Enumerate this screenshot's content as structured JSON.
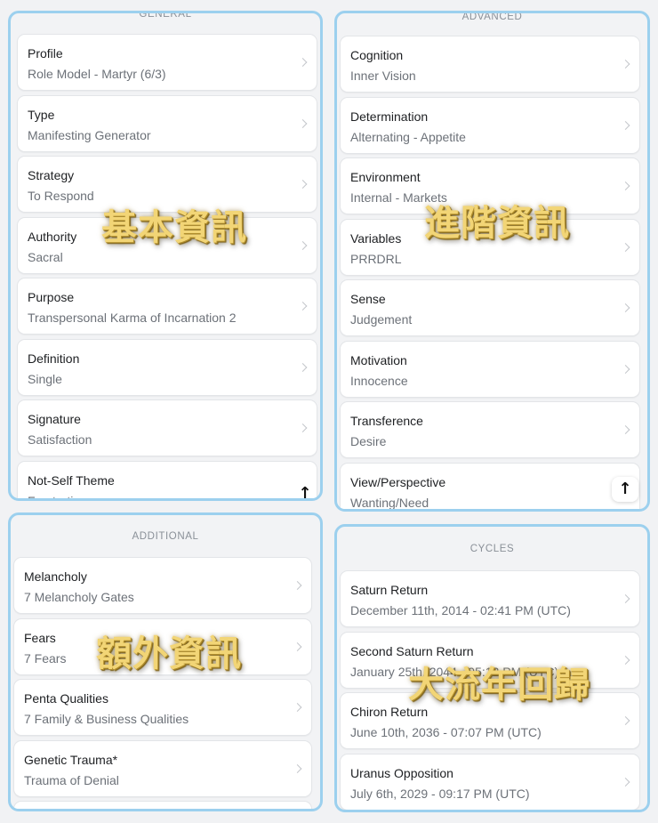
{
  "general": {
    "header": "GENERAL",
    "items": [
      {
        "title": "Profile",
        "value": "Role Model - Martyr (6/3)"
      },
      {
        "title": "Type",
        "value": "Manifesting Generator"
      },
      {
        "title": "Strategy",
        "value": "To Respond"
      },
      {
        "title": "Authority",
        "value": "Sacral"
      },
      {
        "title": "Purpose",
        "value": "Transpersonal Karma of Incarnation 2"
      },
      {
        "title": "Definition",
        "value": "Single"
      },
      {
        "title": "Signature",
        "value": "Satisfaction"
      },
      {
        "title": "Not-Self Theme",
        "value": "Frustration"
      }
    ],
    "overlay": "基本資訊"
  },
  "advanced": {
    "header": "ADVANCED",
    "items": [
      {
        "title": "Cognition",
        "value": "Inner Vision"
      },
      {
        "title": "Determination",
        "value": "Alternating - Appetite"
      },
      {
        "title": "Environment",
        "value": "Internal - Markets"
      },
      {
        "title": "Variables",
        "value": "PRRDRL"
      },
      {
        "title": "Sense",
        "value": "Judgement"
      },
      {
        "title": "Motivation",
        "value": "Innocence"
      },
      {
        "title": "Transference",
        "value": "Desire"
      },
      {
        "title": "View/Perspective",
        "value": "Wanting/Need"
      }
    ],
    "overlay": "進階資訊"
  },
  "additional": {
    "header": "ADDITIONAL",
    "items": [
      {
        "title": "Melancholy",
        "value": "7 Melancholy Gates"
      },
      {
        "title": "Fears",
        "value": "7 Fears"
      },
      {
        "title": "Penta Qualities",
        "value": "7 Family & Business Qualities"
      },
      {
        "title": "Genetic Trauma*",
        "value": "Trauma of Denial"
      }
    ],
    "overlay": "額外資訊"
  },
  "cycles": {
    "header": "CYCLES",
    "items": [
      {
        "title": "Saturn Return",
        "value": "December 11th, 2014 - 02:41 PM (UTC)"
      },
      {
        "title": "Second Saturn Return",
        "value": "January 25th, 2044 - 05:12 PM (UTC)"
      },
      {
        "title": "Chiron Return",
        "value": "June 10th, 2036 - 07:07 PM (UTC)"
      },
      {
        "title": "Uranus Opposition",
        "value": "July 6th, 2029 - 09:17 PM (UTC)"
      }
    ],
    "overlay": "大流年回歸"
  },
  "icons": {
    "chevron": "chevron-right-icon",
    "scroll_top": "arrow-up-icon"
  }
}
